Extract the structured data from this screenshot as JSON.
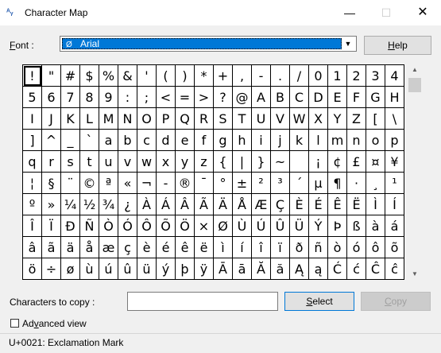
{
  "window": {
    "title": "Character Map",
    "min_glyph": "—",
    "max_glyph": "☐",
    "close_glyph": "✕"
  },
  "font": {
    "label_prefix": "",
    "label_mnemonic": "F",
    "label_rest": "ont :",
    "selected": "Arial",
    "font_icon": "opentype-font-icon"
  },
  "buttons": {
    "help_mnemonic": "H",
    "help_rest": "elp",
    "select_mnemonic": "S",
    "select_rest": "elect",
    "copy_mnemonic": "C",
    "copy_rest": "opy"
  },
  "copy": {
    "label": "Characters to copy :",
    "value": ""
  },
  "advanced": {
    "label_prefix": "Ad",
    "label_mnemonic": "v",
    "label_rest": "anced view",
    "checked": false
  },
  "status": {
    "text": "U+0021: Exclamation Mark"
  },
  "grid": {
    "selected_index": 0,
    "rows": [
      [
        "!",
        "\"",
        "#",
        "$",
        "%",
        "&",
        "'",
        "(",
        ")",
        "*",
        "+",
        ",",
        "-",
        ".",
        "/",
        "0",
        "1",
        "2",
        "3",
        "4"
      ],
      [
        "5",
        "6",
        "7",
        "8",
        "9",
        ":",
        ";",
        "<",
        "=",
        ">",
        "?",
        "@",
        "A",
        "B",
        "C",
        "D",
        "E",
        "F",
        "G",
        "H"
      ],
      [
        "I",
        "J",
        "K",
        "L",
        "M",
        "N",
        "O",
        "P",
        "Q",
        "R",
        "S",
        "T",
        "U",
        "V",
        "W",
        "X",
        "Y",
        "Z",
        "[",
        "\\"
      ],
      [
        "]",
        "^",
        "_",
        "`",
        "a",
        "b",
        "c",
        "d",
        "e",
        "f",
        "g",
        "h",
        "i",
        "j",
        "k",
        "l",
        "m",
        "n",
        "o",
        "p"
      ],
      [
        "q",
        "r",
        "s",
        "t",
        "u",
        "v",
        "w",
        "x",
        "y",
        "z",
        "{",
        "|",
        "}",
        "~",
        " ",
        "¡",
        "¢",
        "£",
        "¤",
        "¥"
      ],
      [
        "¦",
        "§",
        "¨",
        "©",
        "ª",
        "«",
        "¬",
        "-",
        "®",
        "¯",
        "°",
        "±",
        "²",
        "³",
        "´",
        "µ",
        "¶",
        "·",
        "¸",
        "¹"
      ],
      [
        "º",
        "»",
        "¼",
        "½",
        "¾",
        "¿",
        "À",
        "Á",
        "Â",
        "Ã",
        "Ä",
        "Å",
        "Æ",
        "Ç",
        "È",
        "É",
        "Ê",
        "Ë",
        "Ì",
        "Í"
      ],
      [
        "Î",
        "Ï",
        "Ð",
        "Ñ",
        "Ò",
        "Ó",
        "Ô",
        "Õ",
        "Ö",
        "×",
        "Ø",
        "Ù",
        "Ú",
        "Û",
        "Ü",
        "Ý",
        "Þ",
        "ß",
        "à",
        "á"
      ],
      [
        "â",
        "ã",
        "ä",
        "å",
        "æ",
        "ç",
        "è",
        "é",
        "ê",
        "ë",
        "ì",
        "í",
        "î",
        "ï",
        "ð",
        "ñ",
        "ò",
        "ó",
        "ô",
        "õ"
      ],
      [
        "ö",
        "÷",
        "ø",
        "ù",
        "ú",
        "û",
        "ü",
        "ý",
        "þ",
        "ÿ",
        "Ā",
        "ā",
        "Ă",
        "ă",
        "Ą",
        "ą",
        "Ć",
        "ć",
        "Ĉ",
        "ĉ"
      ]
    ]
  }
}
